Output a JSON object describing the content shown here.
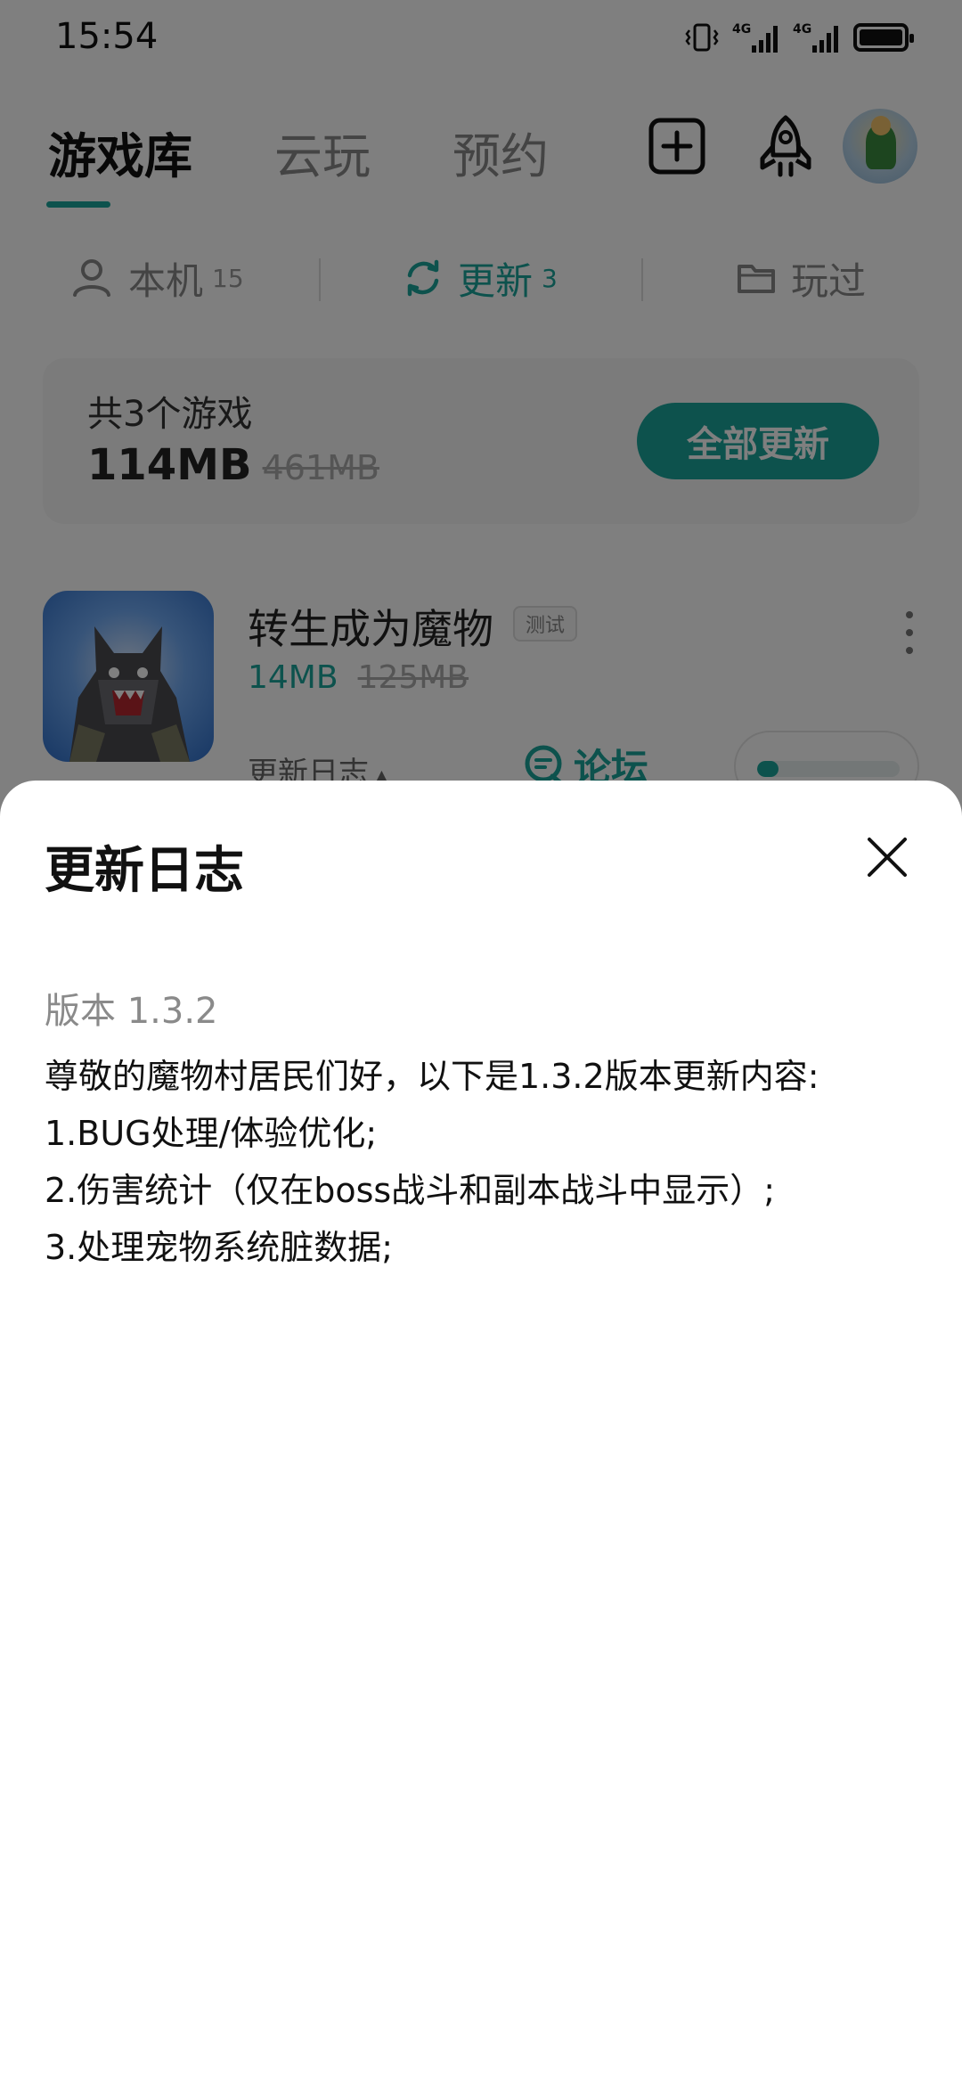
{
  "status_bar": {
    "time": "15:54",
    "icons": [
      "vibrate-icon",
      "signal-4g-icon",
      "signal-4g-icon",
      "battery-icon"
    ]
  },
  "header": {
    "tabs": [
      {
        "label": "游戏库",
        "active": true
      },
      {
        "label": "云玩",
        "active": false
      },
      {
        "label": "预约",
        "active": false
      }
    ],
    "actions": [
      "add-icon",
      "rocket-icon",
      "avatar"
    ]
  },
  "sub_tabs": [
    {
      "label": "本机",
      "count": "15",
      "icon": "user-icon",
      "active": false
    },
    {
      "label": "更新",
      "count": "3",
      "icon": "refresh-icon",
      "active": true
    },
    {
      "label": "玩过",
      "count": "",
      "icon": "folder-icon",
      "active": false
    }
  ],
  "summary": {
    "title": "共3个游戏",
    "size": "114MB",
    "old_size": "461MB",
    "button_label": "全部更新"
  },
  "game": {
    "title": "转生成为魔物",
    "badge": "测试",
    "size": "14MB",
    "old_size": "125MB",
    "changelog_label": "更新日志",
    "forum_label": "论坛",
    "download_progress": 0.15
  },
  "sheet": {
    "title": "更新日志",
    "version": "版本 1.3.2",
    "lines": [
      "尊敬的魔物村居民们好，以下是1.3.2版本更新内容:",
      "1.BUG处理/体验优化;",
      "2.伤害统计（仅在boss战斗和副本战斗中显示）;",
      "3.处理宠物系统脏数据;"
    ]
  },
  "colors": {
    "accent": "#1aa59b",
    "overlay": "rgba(0,0,0,0.5)"
  }
}
